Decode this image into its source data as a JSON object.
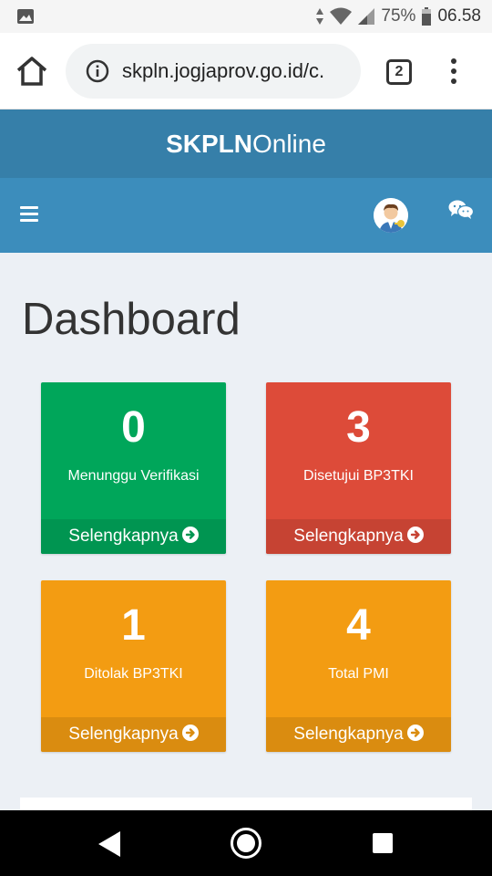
{
  "statusbar": {
    "battery": "75%",
    "time": "06.58"
  },
  "browser": {
    "url": "skpln.jogjaprov.go.id/c.",
    "tab_count": "2"
  },
  "app": {
    "logo_bold": "SKPLN",
    "logo_light": "Online"
  },
  "page": {
    "title": "Dashboard"
  },
  "boxes": [
    {
      "value": "0",
      "label": "Menunggu Verifikasi",
      "link": "Selengkapnya",
      "color": "#00a65a"
    },
    {
      "value": "3",
      "label": "Disetujui BP3TKI",
      "link": "Selengkapnya",
      "color": "#dd4b39"
    },
    {
      "value": "1",
      "label": "Ditolak BP3TKI",
      "link": "Selengkapnya",
      "color": "#f39c12"
    },
    {
      "value": "4",
      "label": "Total PMI",
      "link": "Selengkapnya",
      "color": "#f39c12"
    }
  ],
  "icons": {
    "image": "image-icon",
    "info": "info-icon",
    "home": "home-icon",
    "menu": "more-vert-icon",
    "hamburger": "hamburger-icon",
    "avatar": "user-avatar",
    "chat": "chat-icon",
    "arrow": "arrow-circle-right-icon"
  }
}
